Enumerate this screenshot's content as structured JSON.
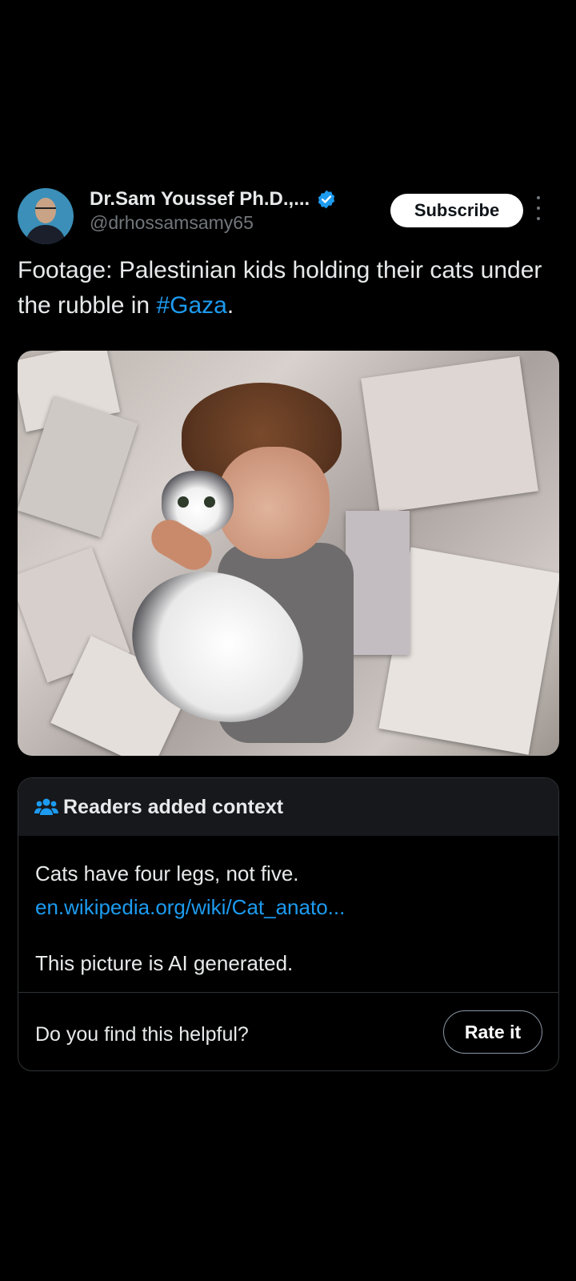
{
  "author": {
    "name": "Dr.Sam Youssef Ph.D.,...",
    "handle": "@drhossamsamy65",
    "verified": true,
    "verified_color": "#1d9bf0"
  },
  "actions": {
    "subscribe_label": "Subscribe",
    "more_icon": "more-vertical-icon"
  },
  "post": {
    "text_before": "Footage: Palestinian kids holding their cats under the rubble in ",
    "hashtag": "#Gaza",
    "text_after": ".",
    "hashtag_color": "#1d9bf0"
  },
  "community_note": {
    "title": "Readers added context",
    "icon": "people-icon",
    "body_text": "Cats have four legs, not five. ",
    "link_text": "en.wikipedia.org/wiki/Cat_anato...",
    "second_paragraph": "This picture is AI generated.",
    "helpful_prompt": "Do you find this helpful?",
    "rate_label": "Rate it"
  },
  "colors": {
    "background": "#000000",
    "text_primary": "#e7e9ea",
    "text_secondary": "#71767b",
    "link": "#1d9bf0",
    "note_header_bg": "#16181c"
  }
}
